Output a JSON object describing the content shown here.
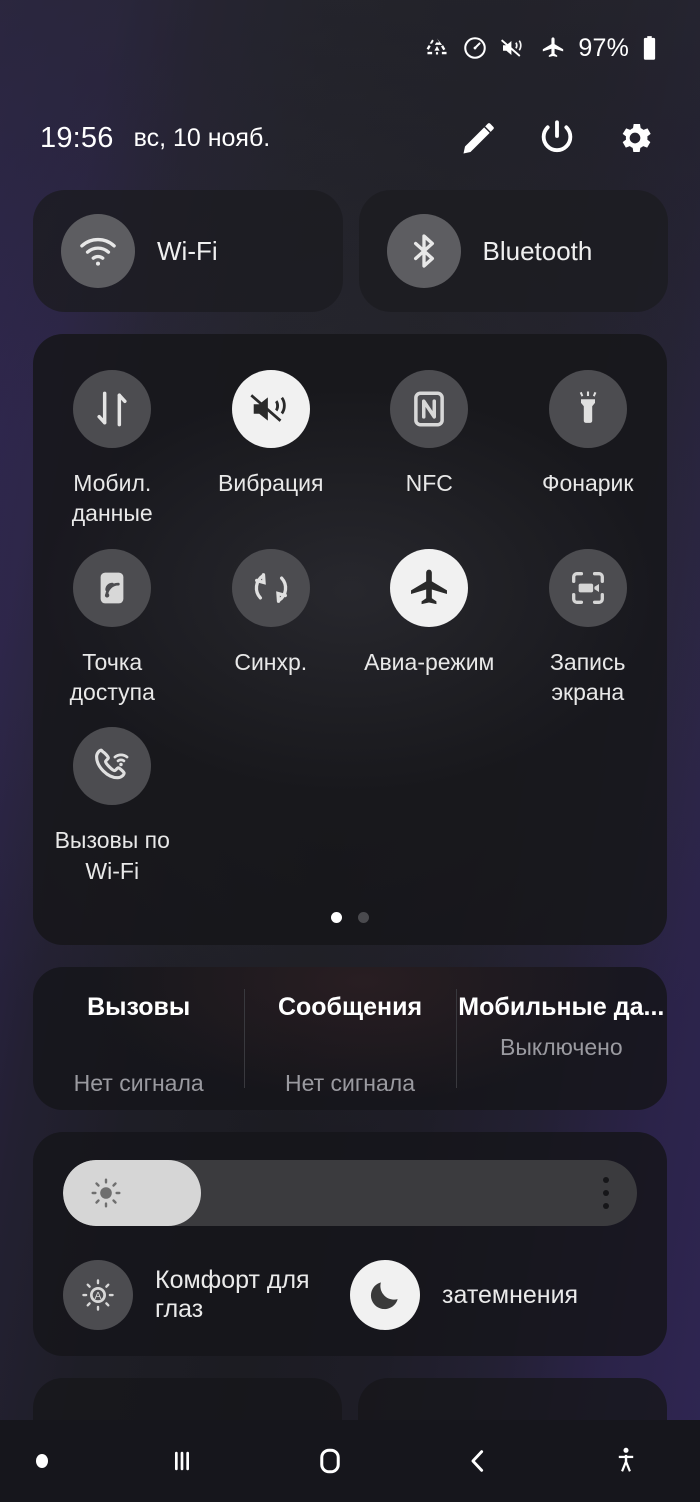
{
  "statusbar": {
    "icons": [
      "data-saver-icon",
      "dashboard-speed-icon",
      "mute-vibrate-icon",
      "airplane-icon"
    ],
    "battery_percent": "97%",
    "battery_icon": "battery-full-icon"
  },
  "header": {
    "time": "19:56",
    "date": "вс, 10 нояб.",
    "actions": [
      {
        "name": "edit-pencil-icon"
      },
      {
        "name": "power-icon"
      },
      {
        "name": "settings-gear-icon"
      }
    ]
  },
  "pills": [
    {
      "label": "Wi-Fi",
      "icon": "wifi-icon",
      "active": false
    },
    {
      "label": "Bluetooth",
      "icon": "bluetooth-icon",
      "active": false
    }
  ],
  "tiles": [
    {
      "label": "Мобил. данные",
      "icon": "mobile-data-icon",
      "active": false
    },
    {
      "label": "Вибрация",
      "icon": "vibrate-icon",
      "active": true
    },
    {
      "label": "NFC",
      "icon": "nfc-icon",
      "active": false
    },
    {
      "label": "Фонарик",
      "icon": "flashlight-icon",
      "active": false
    },
    {
      "label": "Точка доступа",
      "icon": "hotspot-icon",
      "active": false
    },
    {
      "label": "Синхр.",
      "icon": "sync-icon",
      "active": false
    },
    {
      "label": "Авиа-режим",
      "icon": "airplane-icon",
      "active": true
    },
    {
      "label": "Запись экрана",
      "icon": "screen-record-icon",
      "active": false
    },
    {
      "label": "Вызовы по Wi-Fi",
      "icon": "wifi-calling-icon",
      "active": false
    }
  ],
  "pager": {
    "total": 2,
    "current": 1
  },
  "network_status": [
    {
      "title": "Вызовы",
      "status": "Нет сигнала",
      "align": "low"
    },
    {
      "title": "Сообщения",
      "status": "Нет сигнала",
      "align": "low"
    },
    {
      "title": "Мобильные да...",
      "status": "Выключено",
      "align": "high"
    }
  ],
  "brightness": {
    "value_percent": 24,
    "sun_icon": "brightness-sun-icon",
    "menu_icon": "kebab-menu-icon"
  },
  "display_modes": [
    {
      "label": "Комфорт для глаз",
      "icon": "eye-comfort-icon",
      "active": false
    },
    {
      "label": "затемнения",
      "icon": "dark-mode-moon-icon",
      "active": true
    }
  ],
  "navbar": [
    {
      "name": "nav-indicator-dot"
    },
    {
      "name": "recents-icon"
    },
    {
      "name": "home-icon"
    },
    {
      "name": "back-icon"
    },
    {
      "name": "accessibility-icon"
    }
  ],
  "colors": {
    "accent_active": "#f1f1f1",
    "tile_inactive": "#4c4c50",
    "card_bg": "#16161a",
    "wallpaper_purple": "#2e2550"
  }
}
